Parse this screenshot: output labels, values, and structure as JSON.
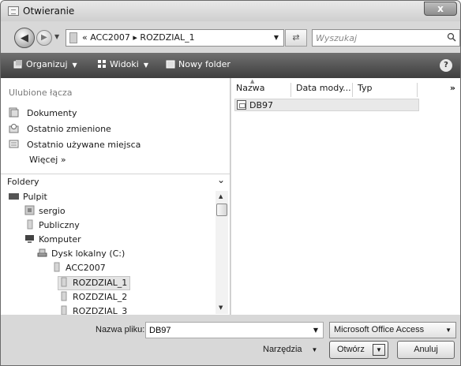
{
  "window": {
    "title": "Otwieranie",
    "close_label": "x"
  },
  "address": {
    "path": "«  ACC2007  ▸  ROZDZIAL_1",
    "search_placeholder": "Wyszukaj"
  },
  "toolbar": {
    "organize": "Organizuj",
    "views": "Widoki",
    "new_folder": "Nowy folder",
    "help": "?"
  },
  "favorites": {
    "title": "Ulubione łącza",
    "items": [
      "Dokumenty",
      "Ostatnio zmienione",
      "Ostatnio używane miejsca"
    ],
    "more": "Więcej  »"
  },
  "folders": {
    "label": "Foldery",
    "items": [
      "Pulpit",
      "sergio",
      "Publiczny",
      "Komputer",
      "Dysk lokalny (C:)",
      "ACC2007",
      "ROZDZIAL_1",
      "ROZDZIAL_2",
      "ROZDZIAL_3"
    ]
  },
  "columns": [
    "Nazwa",
    "Data mody...",
    "Typ"
  ],
  "more_columns": "»",
  "files": [
    "DB97"
  ],
  "bottom": {
    "filename_label": "Nazwa pliku:",
    "filename_value": "DB97",
    "filetype": "Microsoft Office Access",
    "tools": "Narzędzia",
    "open": "Otwórz",
    "cancel": "Anuluj"
  }
}
